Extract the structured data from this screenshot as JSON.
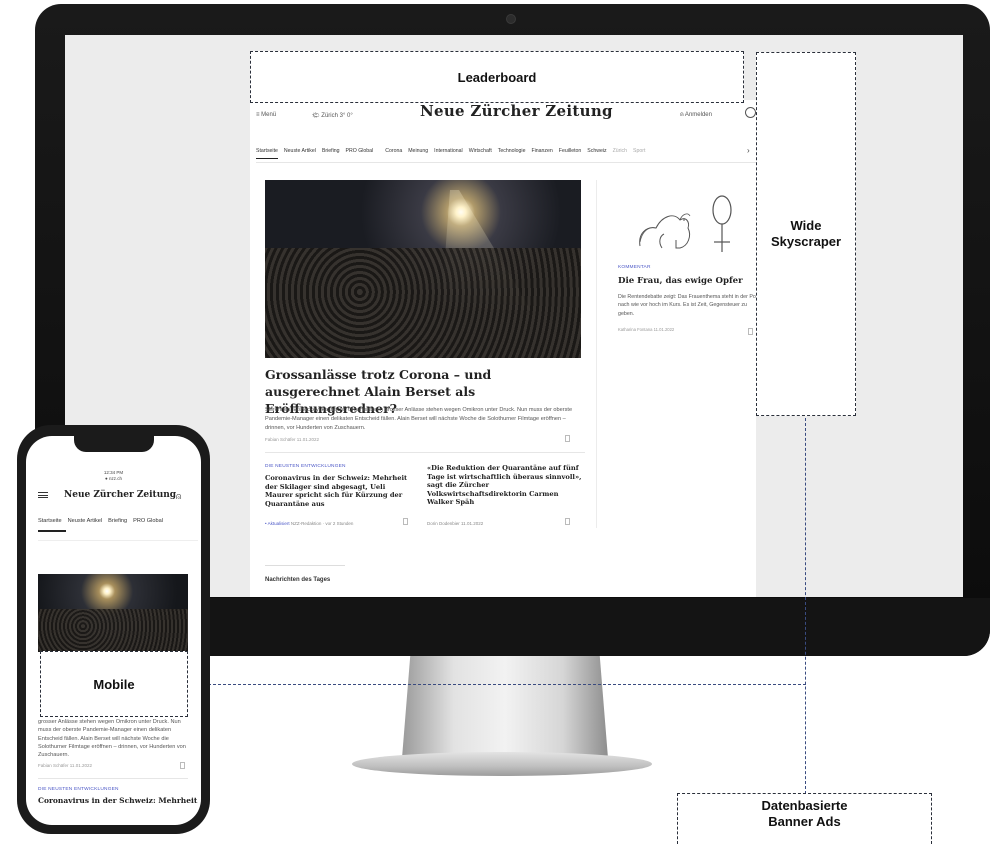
{
  "annotations": {
    "leaderboard": "Leaderboard",
    "skyscraper_line1": "Wide",
    "skyscraper_line2": "Skyscraper",
    "mobile": "Mobile",
    "banner_line1": "Datenbasierte",
    "banner_line2": "Banner Ads"
  },
  "desktop": {
    "menu_label": "≡ Menü",
    "weather": "🌤 Zürich 3° 0°",
    "logo": "Neue Zürcher Zeitung",
    "login": "⍝ Anmelden",
    "nav": {
      "items": [
        "Startseite",
        "Neuste Artikel",
        "Briefing",
        "PRO Global"
      ],
      "sections": [
        "Corona",
        "Meinung",
        "International",
        "Wirtschaft",
        "Technologie",
        "Finanzen",
        "Feuilleton",
        "Schweiz"
      ],
      "faded": [
        "Zürich",
        "Sport"
      ],
      "next": "›"
    },
    "hero": {
      "headline": "Grossanlässe trotz Corona – und ausgerechnet Alain Berset als Eröffnungsredner?",
      "lead": "Skirennen, Eishockey, Fasnacht: Organisatoren grosser Anlässe stehen wegen Omikron unter Druck. Nun muss der oberste Pandemie-Manager einen delikaten Entscheid fällen. Alain Berset will nächste Woche die Solothurner Filmtage eröffnen – drinnen, vor Hunderten von Zuschauern.",
      "byline": "Fabian Schäfer  11.01.2022"
    },
    "story1": {
      "kicker": "DIE NEUSTEN ENTWICKLUNGEN",
      "headline": "Coronavirus in der Schweiz: Mehrheit der Skilager sind abgesagt, Ueli Maurer spricht sich für Kürzung der Quarantäne aus",
      "updated": "• Aktualisiert",
      "meta": "NZZ-Redaktion · vor 2 Stunden"
    },
    "story2": {
      "headline": "«Die Reduktion der Quarantäne auf fünf Tage ist wirtschaftlich überaus sinnvoll», sagt die Zürcher Volkswirtschaftsdirektorin Carmen Walker Späh",
      "meta": "Dorin Dodenbier  11.01.2022"
    },
    "comment": {
      "kicker": "KOMMENTAR",
      "title": "Die Frau, das ewige Opfer",
      "lead": "Die Rentendebatte zeigt: Das Frauenthema steht in der Politik nach wie vor hoch im Kurs. Es ist Zeit, Gegensteuer zu geben.",
      "byline": "Katharina Fontana  11.01.2022"
    },
    "section_title": "Nachrichten des Tages"
  },
  "mobile": {
    "status": [
      "12:34 PM",
      "● nzz.ch"
    ],
    "logo": "Neue Zürcher Zeitung",
    "user_icon": "⍝",
    "nav": [
      "Startseite",
      "Neuste Artikel",
      "Briefing",
      "PRO Global"
    ],
    "lead": "grosser Anlässe stehen wegen Omikron unter Druck. Nun muss der oberste Pandemie-Manager einen delikaten Entscheid fällen. Alain Berset will nächste Woche die Solothurner Filmtage eröffnen – drinnen, vor Hunderten von Zuschauern.",
    "byline": "Fabian Schäfer  11.01.2022",
    "kicker": "DIE NEUSTEN ENTWICKLUNGEN",
    "headline": "Coronavirus in der Schweiz: Mehrheit"
  },
  "icons": {
    "menu": "hamburger-icon",
    "search": "search-icon",
    "user": "user-icon",
    "bookmark": "bookmark-icon",
    "weather": "weather-icon"
  },
  "colors": {
    "accent": "#4a56c6",
    "annotation_line": "#3a4b80",
    "device_frame": "#111111"
  }
}
